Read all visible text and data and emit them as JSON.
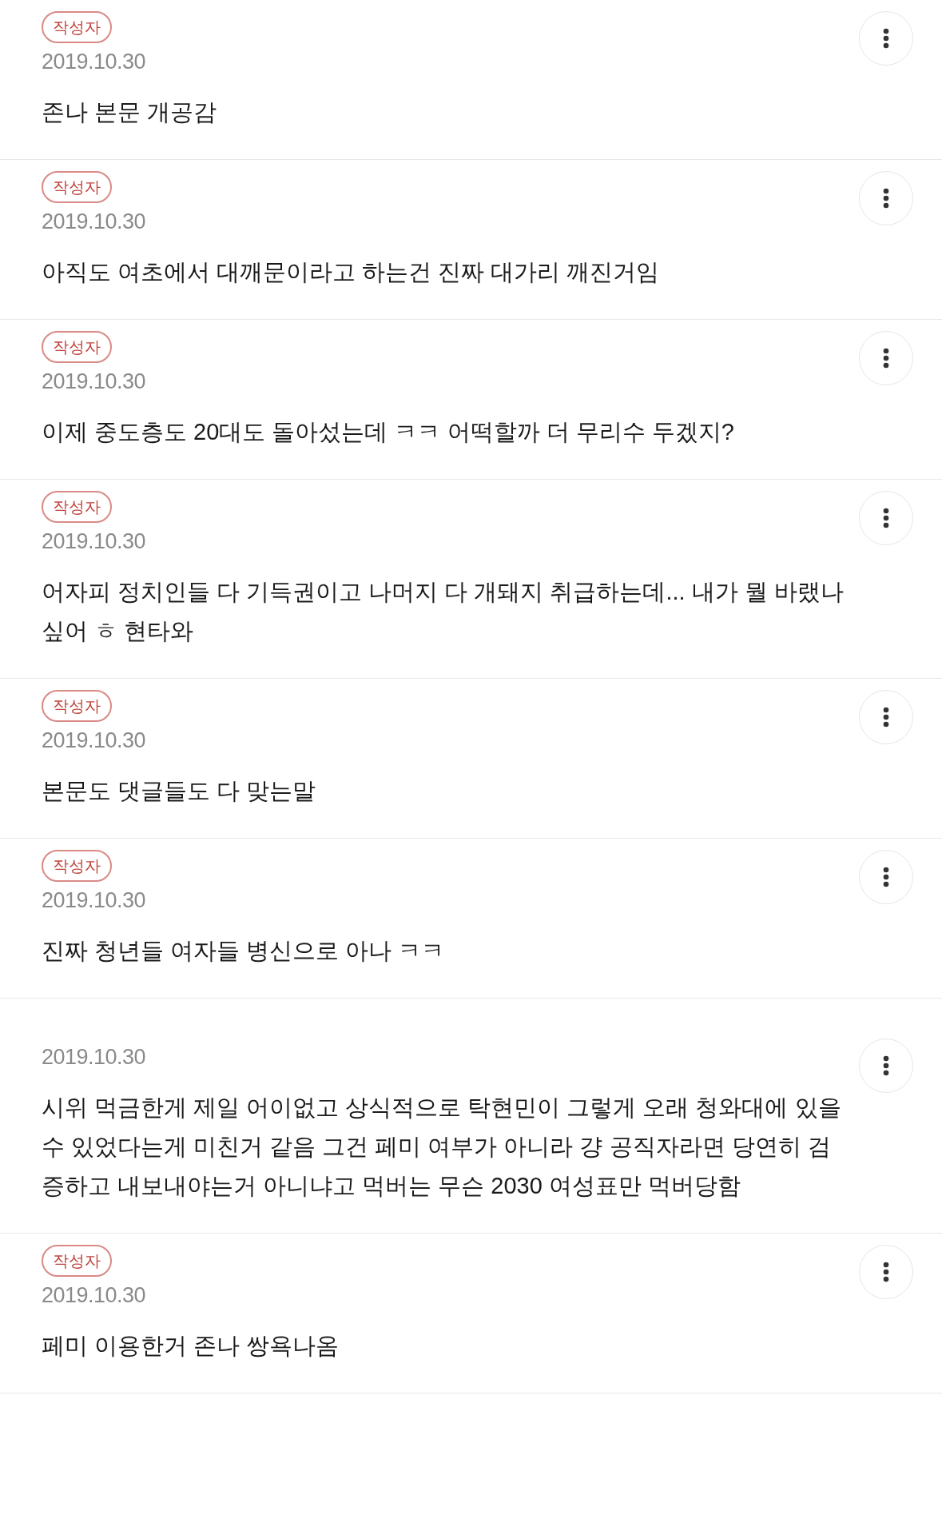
{
  "comments": [
    {
      "badge": "작성자",
      "date": "2019.10.30",
      "text": "존나 본문 개공감"
    },
    {
      "badge": "작성자",
      "date": "2019.10.30",
      "text": "아직도 여초에서 대깨문이라고 하는건 진짜 대가리 깨진거임"
    },
    {
      "badge": "작성자",
      "date": "2019.10.30",
      "text": "이제 중도층도 20대도 돌아섰는데 ㅋㅋ 어떡할까 더 무리수 두겠지?"
    },
    {
      "badge": "작성자",
      "date": "2019.10.30",
      "text": "어자피 정치인들 다 기득권이고 나머지 다 개돼지 취급하는데... 내가 뭘 바랬나 싶어 ㅎ 현타와"
    },
    {
      "badge": "작성자",
      "date": "2019.10.30",
      "text": "본문도 댓글들도 다 맞는말"
    },
    {
      "badge": "작성자",
      "date": "2019.10.30",
      "text": "진짜 청년들 여자들 병신으로 아나 ㅋㅋ"
    },
    {
      "date": "2019.10.30",
      "text": "시위 먹금한게 제일 어이없고 상식적으로 탁현민이 그렇게 오래 청와대에 있을 수 있었다는게 미친거 같음 그건 페미 여부가 아니라 걍 공직자라면 당연히 검증하고 내보내야는거 아니냐고 먹버는 무슨 2030 여성표만 먹버당함"
    },
    {
      "badge": "작성자",
      "date": "2019.10.30",
      "text": "페미 이용한거 존나 쌍욕나옴"
    }
  ]
}
